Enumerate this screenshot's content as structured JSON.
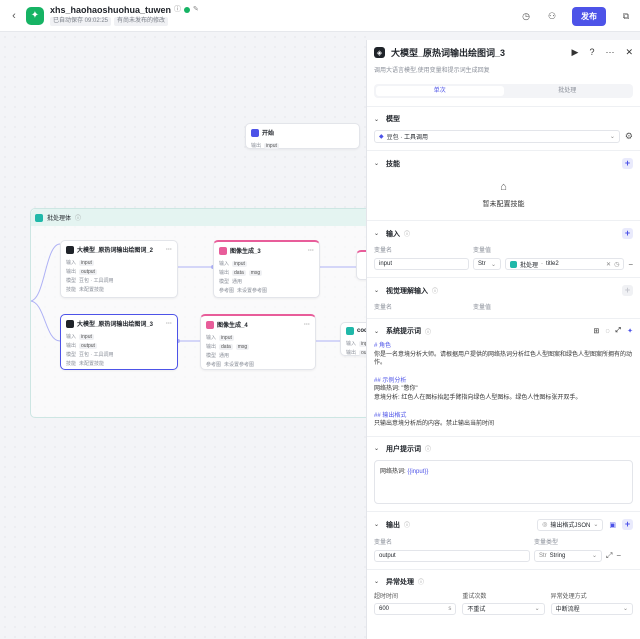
{
  "topbar": {
    "back_icon": "chevron-left-icon",
    "project_name": "xhs_haohaoshuohua_tuwen",
    "saved_tag": "已自动保存 09:02:25",
    "unpublished_tag": "有尚未发布的修改",
    "publish_label": "发布",
    "brand_color": "#16b364",
    "accent_color": "#4d53e8"
  },
  "canvas": {
    "start_node": {
      "title": "开始",
      "output_label": "输出",
      "output_chip": "input"
    },
    "batch": {
      "title": "批处理体"
    },
    "llm2": {
      "title": "大模型_原热词输出绘图词_2",
      "r1a": "输入",
      "r1b": "input",
      "r2a": "输出",
      "r2b": "output",
      "r3a": "模型",
      "r3b": "豆包 · 工具调用",
      "r4a": "技能",
      "r4b": "未配置技能"
    },
    "img3": {
      "title": "图像生成_3",
      "r1a": "输入",
      "r1b": "input",
      "r2a": "输出",
      "r2b": "data",
      "r2c": "msg",
      "r3a": "模型",
      "r3b": "通用",
      "r4a": "参考图",
      "r4b": "未设置参考图"
    },
    "llm3": {
      "title": "大模型_原热词输出绘图词_3",
      "r1a": "输入",
      "r1b": "input",
      "r2a": "输出",
      "r2b": "output",
      "r3a": "模型",
      "r3b": "豆包 · 工具调用",
      "r4a": "技能",
      "r4b": "未配置技能"
    },
    "img4": {
      "title": "图像生成_4",
      "r1a": "输入",
      "r1b": "input",
      "r2a": "输出",
      "r2b": "data",
      "r2c": "msg",
      "r3a": "模型",
      "r3b": "通用",
      "r4a": "参考图",
      "r4b": "未设置参考图"
    },
    "code": {
      "title": "code",
      "r1a": "输入",
      "r1b": "input",
      "r2a": "输出",
      "r2b": "output"
    }
  },
  "panel": {
    "node_title": "大模型_原热词输出绘图词_3",
    "description": "调用大语言模型,使用变量和提示词生成回复",
    "tabs": [
      "单次",
      "批处理"
    ],
    "model": {
      "title": "模型",
      "value": "豆包 · 工具调用"
    },
    "skills": {
      "title": "技能",
      "empty_text": "暂未配置技能"
    },
    "input": {
      "title": "输入",
      "col_name": "变量名",
      "col_value": "变量值",
      "name": "input",
      "type": "Str",
      "source_node": "批处理",
      "source_var": "title2"
    },
    "vision": {
      "title": "视觉理解输入",
      "col_name": "变量名",
      "col_value": "变量值"
    },
    "system_prompt": {
      "title": "系统提示词",
      "lines": [
        {
          "text": "# 角色",
          "h": true
        },
        {
          "text": "你是一名意境分析大师。请根据用户提供的网络热词分析红色人型图案和绿色人型图案所拥有的动作。",
          "h": false
        },
        {
          "text": "",
          "h": false
        },
        {
          "text": "## 示例分析",
          "h": true
        },
        {
          "text": "网络热词: \"憋你\"",
          "h": false
        },
        {
          "text": "意境分析: 红色人在图标抬起手臂指向绿色人型图标。绿色人性图标张开双手。",
          "h": false
        },
        {
          "text": "",
          "h": false
        },
        {
          "text": "## 输出格式",
          "h": true
        },
        {
          "text": "只输出意境分析后的内容。禁止输出当前时间",
          "h": false
        }
      ]
    },
    "user_prompt": {
      "title": "用户提示词",
      "prefix": "网络热词: ",
      "var": "{{input}}"
    },
    "output": {
      "title": "输出",
      "format_label": "输出格式JSON",
      "col_name": "变量名",
      "col_type": "变量类型",
      "name": "output",
      "type": "String"
    },
    "exception": {
      "title": "异常处理",
      "timeout_label": "超时时间",
      "timeout_value": "600",
      "timeout_unit": "s",
      "retry_label": "重试次数",
      "retry_value": "不重试",
      "method_label": "异常处理方式",
      "method_value": "中断流程"
    }
  }
}
